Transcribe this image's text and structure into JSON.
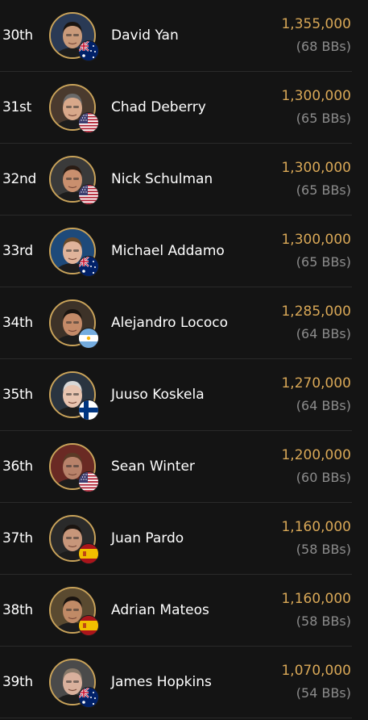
{
  "players": [
    {
      "rank": "30th",
      "name": "David Yan",
      "chips": "1,355,000",
      "bbs": "(68 BBs)",
      "flag": "australia-flag-icon"
    },
    {
      "rank": "31st",
      "name": "Chad Deberry",
      "chips": "1,300,000",
      "bbs": "(65 BBs)",
      "flag": "usa-flag-icon"
    },
    {
      "rank": "32nd",
      "name": "Nick Schulman",
      "chips": "1,300,000",
      "bbs": "(65 BBs)",
      "flag": "usa-flag-icon"
    },
    {
      "rank": "33rd",
      "name": "Michael Addamo",
      "chips": "1,300,000",
      "bbs": "(65 BBs)",
      "flag": "australia-flag-icon"
    },
    {
      "rank": "34th",
      "name": "Alejandro Lococo",
      "chips": "1,285,000",
      "bbs": "(64 BBs)",
      "flag": "argentina-flag-icon"
    },
    {
      "rank": "35th",
      "name": "Juuso Koskela",
      "chips": "1,270,000",
      "bbs": "(64 BBs)",
      "flag": "finland-flag-icon"
    },
    {
      "rank": "36th",
      "name": "Sean Winter",
      "chips": "1,200,000",
      "bbs": "(60 BBs)",
      "flag": "usa-flag-icon"
    },
    {
      "rank": "37th",
      "name": "Juan Pardo",
      "chips": "1,160,000",
      "bbs": "(58 BBs)",
      "flag": "spain-flag-icon"
    },
    {
      "rank": "38th",
      "name": "Adrian Mateos",
      "chips": "1,160,000",
      "bbs": "(58 BBs)",
      "flag": "spain-flag-icon"
    },
    {
      "rank": "39th",
      "name": "James Hopkins",
      "chips": "1,070,000",
      "bbs": "(54 BBs)",
      "flag": "australia-flag-icon"
    }
  ],
  "colors": {
    "background": "#141414",
    "chips": "#d9a857",
    "bbs": "#8c8c8c",
    "avatar_ring": "#c9a35a",
    "divider": "#2a2a2a"
  }
}
